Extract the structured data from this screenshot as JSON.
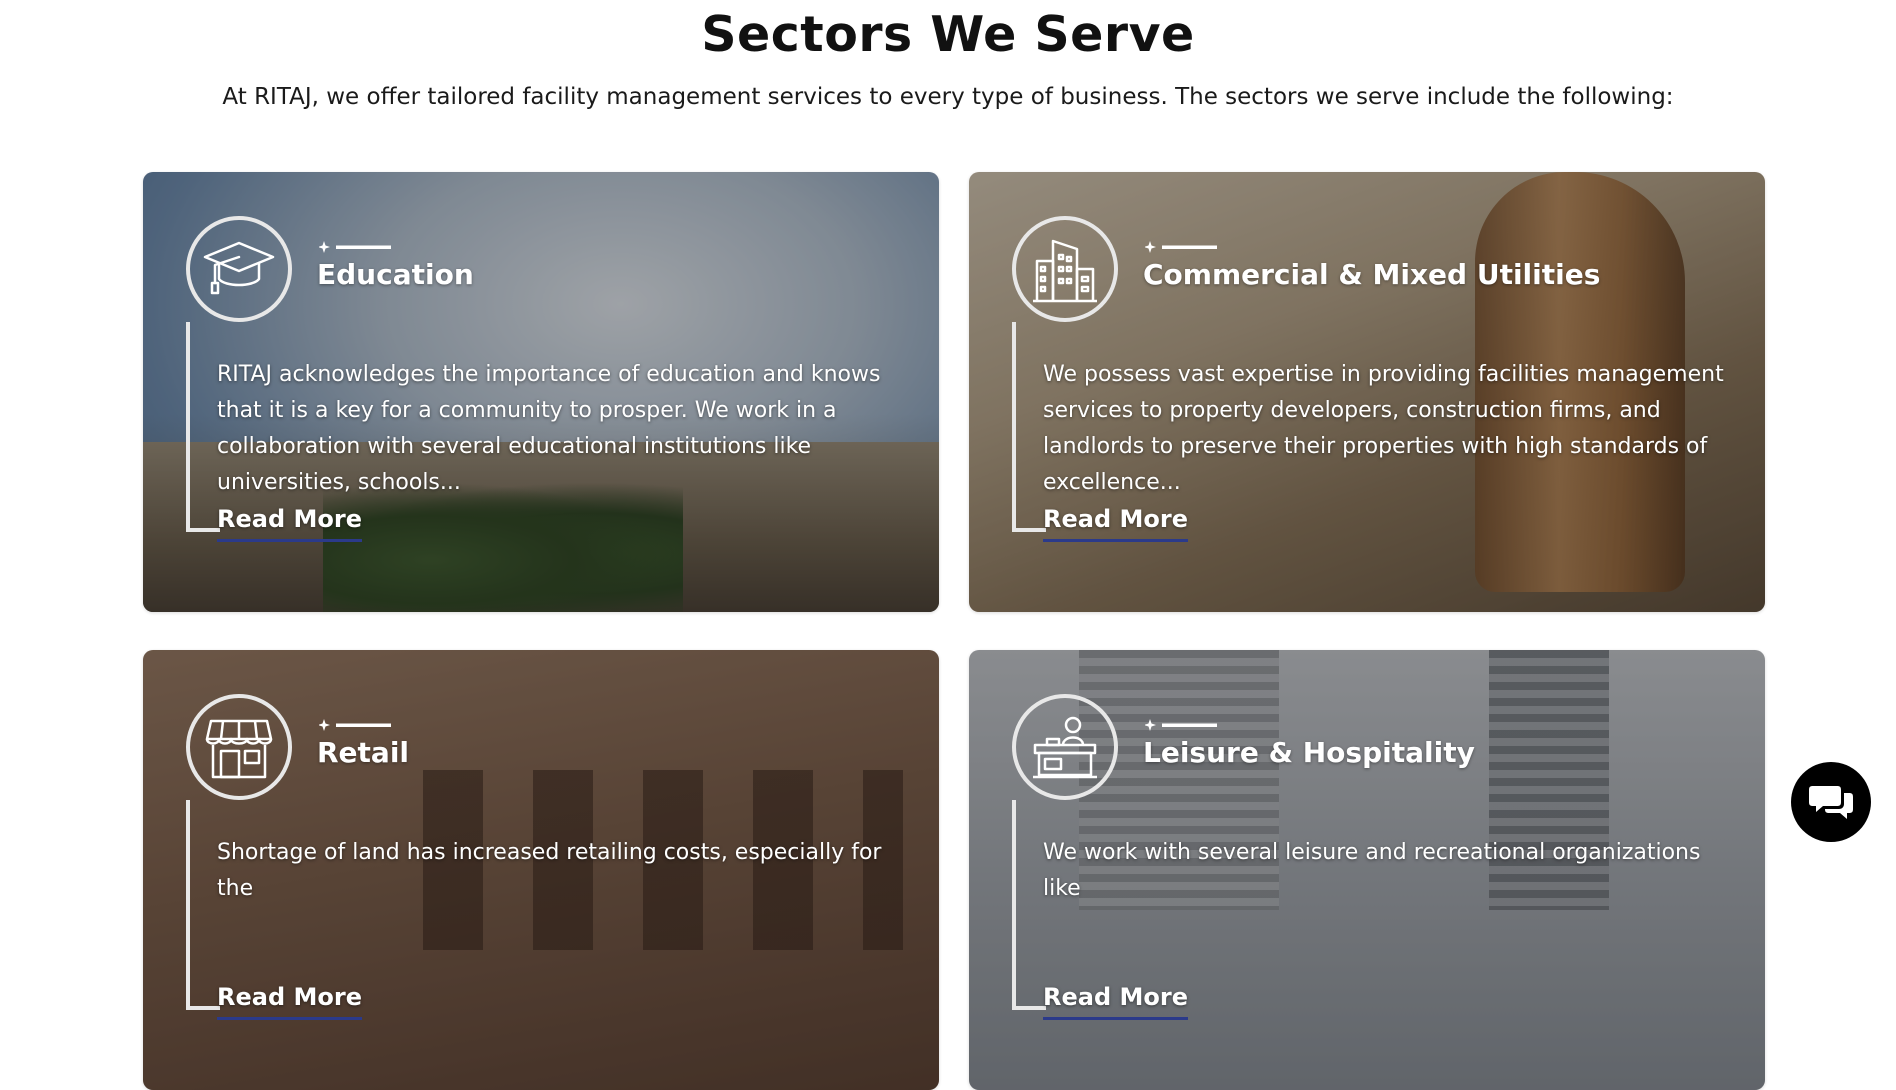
{
  "header": {
    "title": "Sectors We Serve",
    "subtitle": "At RITAJ, we offer tailored facility management services to every type of business. The sectors we serve include the following:"
  },
  "cards": [
    {
      "title": "Education",
      "icon": "graduation-cap-icon",
      "description": "RITAJ acknowledges the importance of education and knows that it is a key for a community to prosper. We work in a collaboration with several educational institutions like universities, schools...",
      "read_more": "Read More"
    },
    {
      "title": "Commercial & Mixed Utilities",
      "icon": "buildings-icon",
      "description": "We possess vast expertise in providing facilities management services to property developers, construction firms, and landlords to preserve their properties with high standards of excellence...",
      "read_more": "Read More"
    },
    {
      "title": "Retail",
      "icon": "storefront-icon",
      "description": "Shortage of land has increased retailing costs, especially for the",
      "read_more": "Read More"
    },
    {
      "title": "Leisure & Hospitality",
      "icon": "reception-desk-icon",
      "description": "We work with several leisure and recreational organizations like",
      "read_more": "Read More"
    }
  ],
  "chat": {
    "icon": "chat-bubbles-icon"
  },
  "colors": {
    "read_more_underline": "#2b3a8a",
    "icon_stroke": "#e8e8e8",
    "chat_button_bg": "#000000"
  }
}
